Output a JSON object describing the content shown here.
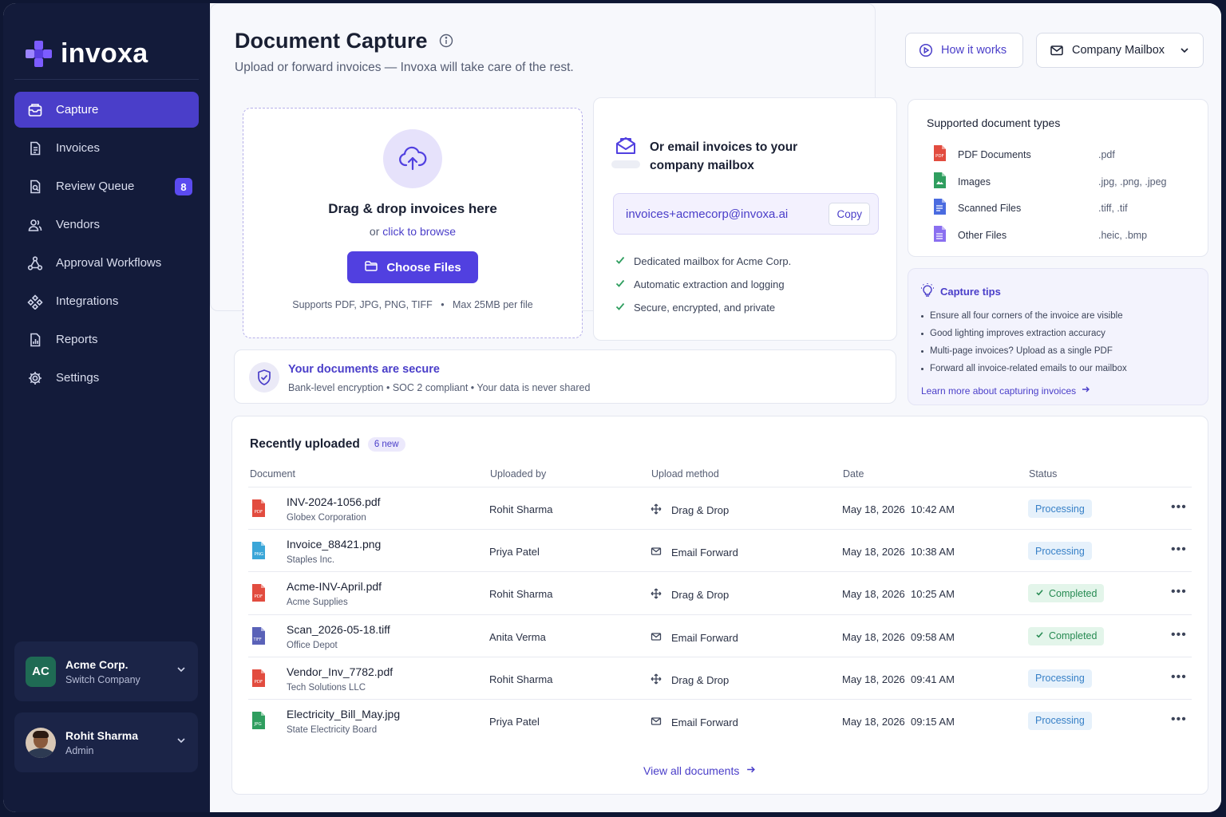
{
  "brand": {
    "name": "invoxa",
    "accent": "#5140e0"
  },
  "sidebar": {
    "items": [
      {
        "label": "Capture",
        "icon": "inbox-icon",
        "active": true
      },
      {
        "label": "Invoices",
        "icon": "document-icon"
      },
      {
        "label": "Review Queue",
        "icon": "review-icon",
        "badge": "8"
      },
      {
        "label": "Vendors",
        "icon": "users-icon"
      },
      {
        "label": "Approval Workflows",
        "icon": "workflow-icon"
      },
      {
        "label": "Integrations",
        "icon": "puzzle-icon"
      },
      {
        "label": "Reports",
        "icon": "chart-icon"
      },
      {
        "label": "Settings",
        "icon": "gear-icon"
      }
    ],
    "company": {
      "initials": "AC",
      "name": "Acme Corp.",
      "action": "Switch Company"
    },
    "user": {
      "name": "Rohit Sharma",
      "role": "Admin"
    }
  },
  "header": {
    "title": "Document Capture",
    "subtitle": "Upload or forward invoices — Invoxa will take care of the rest.",
    "how_label": "How it works",
    "mailbox_label": "Company Mailbox"
  },
  "upload": {
    "title": "Drag & drop invoices here",
    "sub_prefix": "or ",
    "sub_link": "click to browse",
    "button": "Choose Files",
    "note": "Supports PDF, JPG, PNG, TIFF   •   Max 25MB per file"
  },
  "email": {
    "title": "Or email invoices to your company mailbox",
    "address": "invoices+acmecorp@invoxa.ai",
    "copy_label": "Copy",
    "features": [
      "Dedicated mailbox for Acme Corp.",
      "Automatic extraction and logging",
      "Secure, encrypted, and private"
    ]
  },
  "security": {
    "title": "Your documents are secure",
    "subtitle": "Bank-level encryption • SOC 2 compliant • Your data is never shared"
  },
  "types": {
    "title": "Supported document types",
    "items": [
      {
        "name": "PDF Documents",
        "ext": ".pdf",
        "color": "#e24c3f"
      },
      {
        "name": "Images",
        "ext": ".jpg, .png, .jpeg",
        "color": "#2f9e5f"
      },
      {
        "name": "Scanned Files",
        "ext": ".tiff, .tif",
        "color": "#4a6be0"
      },
      {
        "name": "Other Files",
        "ext": ".heic, .bmp",
        "color": "#8a6ff0"
      }
    ]
  },
  "tips": {
    "title": "Capture tips",
    "items": [
      "Ensure all four corners of the invoice are visible",
      "Good lighting improves extraction accuracy",
      "Multi-page invoices? Upload as a single PDF",
      "Forward all invoice-related emails to our mailbox"
    ],
    "link": "Learn more about capturing invoices"
  },
  "recent": {
    "title": "Recently uploaded",
    "badge": "6 new",
    "columns": [
      "Document",
      "Uploaded by",
      "Upload method",
      "Date",
      "Status"
    ],
    "rows": [
      {
        "file": "INV-2024-1056.pdf",
        "vendor": "Globex Corporation",
        "type": "PDF",
        "by": "Rohit Sharma",
        "method": "Drag & Drop",
        "date": "May 18, 2026  10:42 AM",
        "status": "Processing"
      },
      {
        "file": "Invoice_88421.png",
        "vendor": "Staples Inc.",
        "type": "PNG",
        "by": "Priya Patel",
        "method": "Email Forward",
        "date": "May 18, 2026  10:38 AM",
        "status": "Processing"
      },
      {
        "file": "Acme-INV-April.pdf",
        "vendor": "Acme Supplies",
        "type": "PDF",
        "by": "Rohit Sharma",
        "method": "Drag & Drop",
        "date": "May 18, 2026  10:25 AM",
        "status": "Completed"
      },
      {
        "file": "Scan_2026-05-18.tiff",
        "vendor": "Office Depot",
        "type": "TIFF",
        "by": "Anita Verma",
        "method": "Email Forward",
        "date": "May 18, 2026  09:58 AM",
        "status": "Completed"
      },
      {
        "file": "Vendor_Inv_7782.pdf",
        "vendor": "Tech Solutions LLC",
        "type": "PDF",
        "by": "Rohit Sharma",
        "method": "Drag & Drop",
        "date": "May 18, 2026  09:41 AM",
        "status": "Processing"
      },
      {
        "file": "Electricity_Bill_May.jpg",
        "vendor": "State Electricity Board",
        "type": "JPG",
        "by": "Priya Patel",
        "method": "Email Forward",
        "date": "May 18, 2026  09:15 AM",
        "status": "Processing"
      }
    ],
    "view_all": "View all documents"
  }
}
